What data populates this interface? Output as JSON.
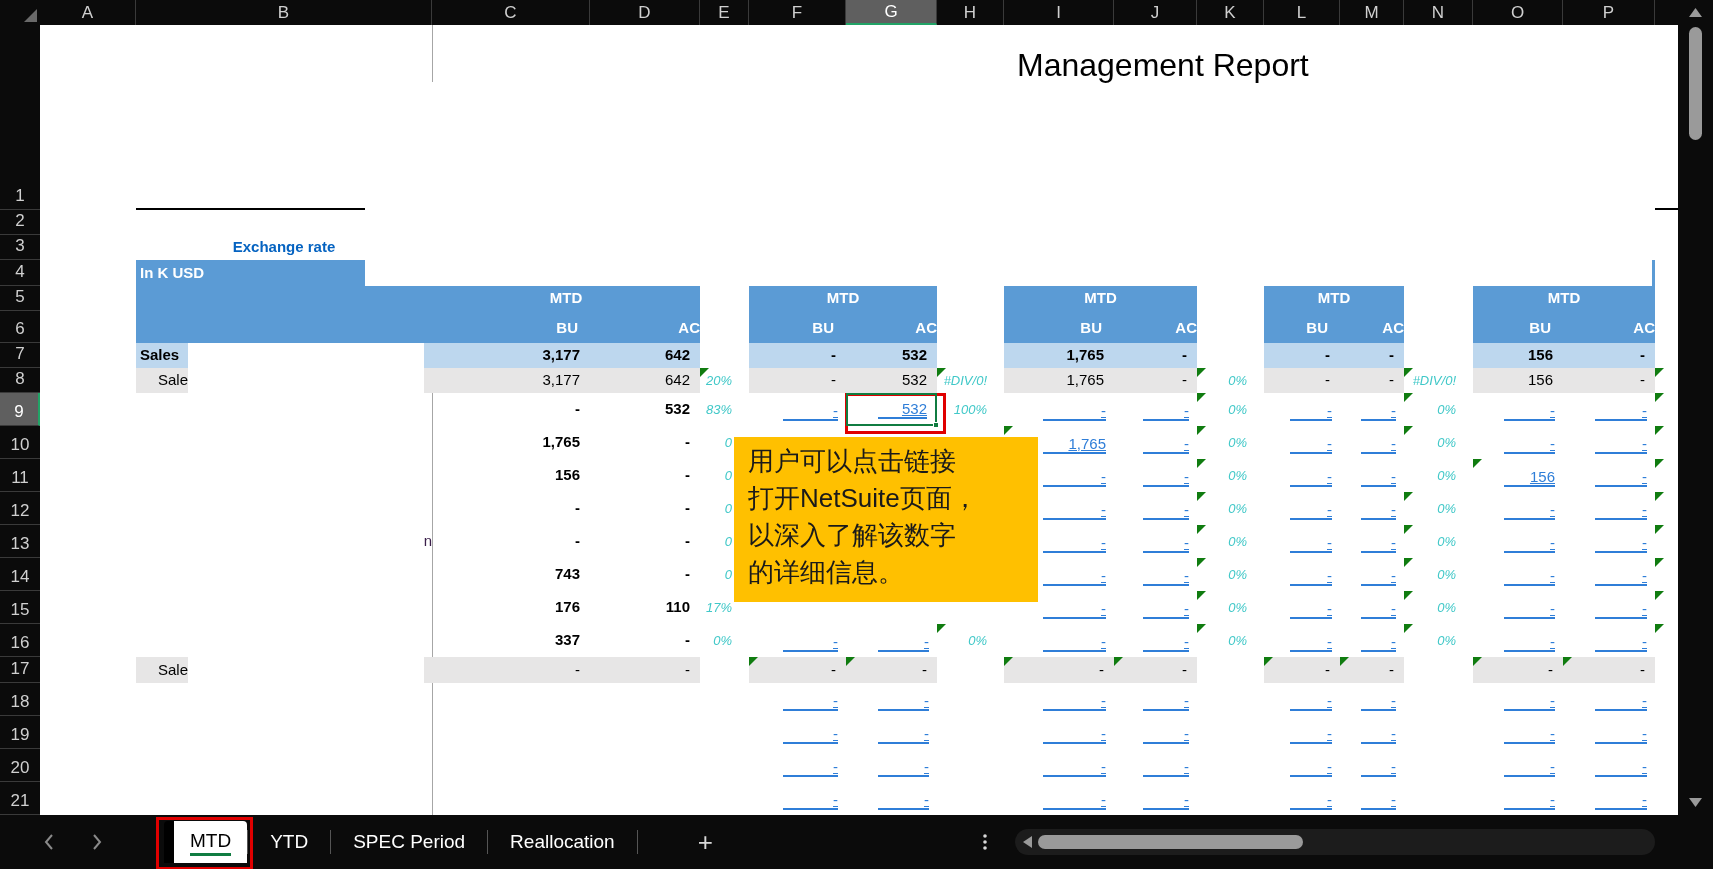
{
  "title": "Management Report",
  "columns": [
    {
      "letter": "A",
      "selected": false,
      "band": false
    },
    {
      "letter": "B",
      "selected": false,
      "band": true
    },
    {
      "letter": "C",
      "selected": false,
      "band": true,
      "group_title": "MTD",
      "subhead": "BU"
    },
    {
      "letter": "D",
      "selected": false,
      "band": true,
      "subhead": "AC"
    },
    {
      "letter": "E",
      "selected": false,
      "band": false
    },
    {
      "letter": "F",
      "selected": false,
      "band": true,
      "group_title": "MTD",
      "subhead": "BU"
    },
    {
      "letter": "G",
      "selected": true,
      "band": true,
      "subhead": "AC"
    },
    {
      "letter": "H",
      "selected": false,
      "band": false
    },
    {
      "letter": "I",
      "selected": false,
      "band": true,
      "group_title": "MTD",
      "subhead": "BU"
    },
    {
      "letter": "J",
      "selected": false,
      "band": true,
      "subhead": "AC"
    },
    {
      "letter": "K",
      "selected": false,
      "band": false
    },
    {
      "letter": "L",
      "selected": false,
      "band": true,
      "group_title": "MTD",
      "subhead": "BU"
    },
    {
      "letter": "M",
      "selected": false,
      "band": true,
      "subhead": "AC"
    },
    {
      "letter": "N",
      "selected": false,
      "band": false
    },
    {
      "letter": "O",
      "selected": false,
      "band": true,
      "group_title": "MTD",
      "subhead": "BU"
    },
    {
      "letter": "P",
      "selected": false,
      "band": true,
      "subhead": "AC"
    }
  ],
  "rows": [
    {
      "number": "1",
      "selected": false,
      "kind": "plain",
      "cells": {}
    },
    {
      "number": "2",
      "selected": false,
      "kind": "plain",
      "cells": {}
    },
    {
      "number": "3",
      "selected": false,
      "kind": "plain",
      "cells": {
        "B": {
          "kind": "note",
          "text": "Exchange rate",
          "flag": false
        }
      }
    },
    {
      "number": "4",
      "selected": false,
      "kind": "plain",
      "cells": {
        "B": {
          "kind": "band_label",
          "text": "In K USD",
          "flag": false
        }
      }
    },
    {
      "number": "5",
      "selected": false,
      "kind": "plain",
      "cells": {}
    },
    {
      "number": "6",
      "selected": false,
      "kind": "plain",
      "cells": {}
    },
    {
      "number": "7",
      "selected": false,
      "kind": "total",
      "cells": {
        "B": {
          "kind": "label",
          "text": "Sales",
          "flag": false
        },
        "C": {
          "kind": "bold",
          "text": "3,177",
          "flag": false
        },
        "D": {
          "kind": "bold",
          "text": "642",
          "flag": false
        },
        "F": {
          "kind": "bold",
          "text": "-",
          "flag": false
        },
        "G": {
          "kind": "bold",
          "text": "532",
          "flag": false
        },
        "I": {
          "kind": "bold",
          "text": "1,765",
          "flag": false
        },
        "J": {
          "kind": "bold",
          "text": "-",
          "flag": false
        },
        "L": {
          "kind": "bold",
          "text": "-",
          "flag": false
        },
        "M": {
          "kind": "bold",
          "text": "-",
          "flag": false
        },
        "O": {
          "kind": "bold",
          "text": "156",
          "flag": false
        },
        "P": {
          "kind": "bold",
          "text": "-",
          "flag": false
        }
      }
    },
    {
      "number": "8",
      "selected": false,
      "kind": "subtotal",
      "cells": {
        "B": {
          "kind": "sublabel",
          "text": "Sale",
          "flag": false
        },
        "C": {
          "kind": "value",
          "text": "3,177",
          "flag": false
        },
        "D": {
          "kind": "value",
          "text": "642",
          "flag": false
        },
        "E": {
          "kind": "pct",
          "text": "20%",
          "flag": true
        },
        "F": {
          "kind": "value",
          "text": "-",
          "flag": false
        },
        "G": {
          "kind": "value",
          "text": "532",
          "flag": false
        },
        "H": {
          "kind": "pct",
          "text": "#DIV/0!",
          "flag": true
        },
        "I": {
          "kind": "value",
          "text": "1,765",
          "flag": false
        },
        "J": {
          "kind": "value",
          "text": "-",
          "flag": false
        },
        "K": {
          "kind": "pct",
          "text": "0%",
          "flag": true
        },
        "L": {
          "kind": "value",
          "text": "-",
          "flag": false
        },
        "M": {
          "kind": "value",
          "text": "-",
          "flag": false
        },
        "N": {
          "kind": "pct",
          "text": "#DIV/0!",
          "flag": true
        },
        "O": {
          "kind": "value",
          "text": "156",
          "flag": false
        },
        "P": {
          "kind": "value",
          "text": "-",
          "flag": false
        },
        "Q": {
          "flag": true
        }
      }
    },
    {
      "number": "9",
      "selected": true,
      "kind": "plain",
      "cells": {
        "C": {
          "kind": "bold",
          "text": "-",
          "flag": false
        },
        "D": {
          "kind": "bold",
          "text": "532",
          "flag": false
        },
        "E": {
          "kind": "pct",
          "text": "83%",
          "flag": false
        },
        "F": {
          "kind": "link",
          "text": "-",
          "flag": false
        },
        "G": {
          "kind": "link",
          "text": "532",
          "flag": false
        },
        "H": {
          "kind": "pct",
          "text": "100%",
          "flag": false
        },
        "I": {
          "kind": "link",
          "text": "-",
          "flag": false
        },
        "J": {
          "kind": "link",
          "text": "-",
          "flag": false
        },
        "K": {
          "kind": "pct",
          "text": "0%",
          "flag": true
        },
        "L": {
          "kind": "link",
          "text": "-",
          "flag": false
        },
        "M": {
          "kind": "link",
          "text": "-",
          "flag": false
        },
        "N": {
          "kind": "pct",
          "text": "0%",
          "flag": true
        },
        "O": {
          "kind": "link",
          "text": "-",
          "flag": false
        },
        "P": {
          "kind": "link",
          "text": "-",
          "flag": false
        },
        "Q": {
          "flag": true
        }
      }
    },
    {
      "number": "10",
      "selected": false,
      "kind": "plain",
      "cells": {
        "C": {
          "kind": "bold",
          "text": "1,765",
          "flag": false
        },
        "D": {
          "kind": "bold",
          "text": "-",
          "flag": false
        },
        "E": {
          "kind": "pct",
          "text": "0",
          "flag": false
        },
        "I": {
          "kind": "link",
          "text": "1,765",
          "flag": true
        },
        "J": {
          "kind": "link",
          "text": "-",
          "flag": false
        },
        "K": {
          "kind": "pct",
          "text": "0%",
          "flag": true
        },
        "L": {
          "kind": "link",
          "text": "-",
          "flag": false
        },
        "M": {
          "kind": "link",
          "text": "-",
          "flag": false
        },
        "N": {
          "kind": "pct",
          "text": "0%",
          "flag": true
        },
        "O": {
          "kind": "link",
          "text": "-",
          "flag": false
        },
        "P": {
          "kind": "link",
          "text": "-",
          "flag": false
        },
        "Q": {
          "flag": true
        }
      }
    },
    {
      "number": "11",
      "selected": false,
      "kind": "plain",
      "cells": {
        "C": {
          "kind": "bold",
          "text": "156",
          "flag": false
        },
        "D": {
          "kind": "bold",
          "text": "-",
          "flag": false
        },
        "E": {
          "kind": "pct",
          "text": "0",
          "flag": false
        },
        "I": {
          "kind": "link",
          "text": "-",
          "flag": false
        },
        "J": {
          "kind": "link",
          "text": "-",
          "flag": false
        },
        "K": {
          "kind": "pct",
          "text": "0%",
          "flag": true
        },
        "L": {
          "kind": "link",
          "text": "-",
          "flag": false
        },
        "M": {
          "kind": "link",
          "text": "-",
          "flag": false
        },
        "N": {
          "kind": "pct",
          "text": "0%",
          "flag": false
        },
        "O": {
          "kind": "link",
          "text": "156",
          "flag": true
        },
        "P": {
          "kind": "link",
          "text": "-",
          "flag": false
        },
        "Q": {
          "flag": true
        }
      }
    },
    {
      "number": "12",
      "selected": false,
      "kind": "plain",
      "cells": {
        "C": {
          "kind": "bold",
          "text": "-",
          "flag": false
        },
        "D": {
          "kind": "bold",
          "text": "-",
          "flag": false
        },
        "E": {
          "kind": "pct",
          "text": "0",
          "flag": false
        },
        "I": {
          "kind": "link",
          "text": "-",
          "flag": false
        },
        "J": {
          "kind": "link",
          "text": "-",
          "flag": false
        },
        "K": {
          "kind": "pct",
          "text": "0%",
          "flag": true
        },
        "L": {
          "kind": "link",
          "text": "-",
          "flag": false
        },
        "M": {
          "kind": "link",
          "text": "-",
          "flag": false
        },
        "N": {
          "kind": "pct",
          "text": "0%",
          "flag": true
        },
        "O": {
          "kind": "link",
          "text": "-",
          "flag": false
        },
        "P": {
          "kind": "link",
          "text": "-",
          "flag": false
        },
        "Q": {
          "flag": true
        }
      }
    },
    {
      "number": "13",
      "selected": false,
      "kind": "plain",
      "cells": {
        "B": {
          "kind": "fragment",
          "text": "n",
          "flag": false
        },
        "C": {
          "kind": "bold",
          "text": "-",
          "flag": false
        },
        "D": {
          "kind": "bold",
          "text": "-",
          "flag": false
        },
        "E": {
          "kind": "pct",
          "text": "0",
          "flag": false
        },
        "I": {
          "kind": "link",
          "text": "-",
          "flag": false
        },
        "J": {
          "kind": "link",
          "text": "-",
          "flag": false
        },
        "K": {
          "kind": "pct",
          "text": "0%",
          "flag": true
        },
        "L": {
          "kind": "link",
          "text": "-",
          "flag": false
        },
        "M": {
          "kind": "link",
          "text": "-",
          "flag": false
        },
        "N": {
          "kind": "pct",
          "text": "0%",
          "flag": true
        },
        "O": {
          "kind": "link",
          "text": "-",
          "flag": false
        },
        "P": {
          "kind": "link",
          "text": "-",
          "flag": false
        },
        "Q": {
          "flag": true
        }
      }
    },
    {
      "number": "14",
      "selected": false,
      "kind": "plain",
      "cells": {
        "C": {
          "kind": "bold",
          "text": "743",
          "flag": false
        },
        "D": {
          "kind": "bold",
          "text": "-",
          "flag": false
        },
        "E": {
          "kind": "pct",
          "text": "0",
          "flag": false
        },
        "I": {
          "kind": "link",
          "text": "-",
          "flag": false
        },
        "J": {
          "kind": "link",
          "text": "-",
          "flag": false
        },
        "K": {
          "kind": "pct",
          "text": "0%",
          "flag": true
        },
        "L": {
          "kind": "link",
          "text": "-",
          "flag": false
        },
        "M": {
          "kind": "link",
          "text": "-",
          "flag": false
        },
        "N": {
          "kind": "pct",
          "text": "0%",
          "flag": true
        },
        "O": {
          "kind": "link",
          "text": "-",
          "flag": false
        },
        "P": {
          "kind": "link",
          "text": "-",
          "flag": false
        },
        "Q": {
          "flag": true
        }
      }
    },
    {
      "number": "15",
      "selected": false,
      "kind": "plain",
      "cells": {
        "C": {
          "kind": "bold",
          "text": "176",
          "flag": false
        },
        "D": {
          "kind": "bold",
          "text": "110",
          "flag": false
        },
        "E": {
          "kind": "pct",
          "text": "17%",
          "flag": false
        },
        "I": {
          "kind": "link",
          "text": "-",
          "flag": false
        },
        "J": {
          "kind": "link",
          "text": "-",
          "flag": false
        },
        "K": {
          "kind": "pct",
          "text": "0%",
          "flag": true
        },
        "L": {
          "kind": "link",
          "text": "-",
          "flag": false
        },
        "M": {
          "kind": "link",
          "text": "-",
          "flag": false
        },
        "N": {
          "kind": "pct",
          "text": "0%",
          "flag": true
        },
        "O": {
          "kind": "link",
          "text": "-",
          "flag": false
        },
        "P": {
          "kind": "link",
          "text": "-",
          "flag": false
        },
        "Q": {
          "flag": true
        }
      }
    },
    {
      "number": "16",
      "selected": false,
      "kind": "plain",
      "cells": {
        "C": {
          "kind": "bold",
          "text": "337",
          "flag": false
        },
        "D": {
          "kind": "bold",
          "text": "-",
          "flag": false
        },
        "E": {
          "kind": "pct",
          "text": "0%",
          "flag": false
        },
        "F": {
          "kind": "link",
          "text": "-",
          "flag": false
        },
        "G": {
          "kind": "link",
          "text": "-",
          "flag": false
        },
        "H": {
          "kind": "pct",
          "text": "0%",
          "flag": true
        },
        "I": {
          "kind": "link",
          "text": "-",
          "flag": false
        },
        "J": {
          "kind": "link",
          "text": "-",
          "flag": false
        },
        "K": {
          "kind": "pct",
          "text": "0%",
          "flag": true
        },
        "L": {
          "kind": "link",
          "text": "-",
          "flag": false
        },
        "M": {
          "kind": "link",
          "text": "-",
          "flag": false
        },
        "N": {
          "kind": "pct",
          "text": "0%",
          "flag": true
        },
        "O": {
          "kind": "link",
          "text": "-",
          "flag": false
        },
        "P": {
          "kind": "link",
          "text": "-",
          "flag": false
        },
        "Q": {
          "flag": true
        }
      }
    },
    {
      "number": "17",
      "selected": false,
      "kind": "subtotal",
      "cells": {
        "B": {
          "kind": "sublabel",
          "text": "Sale",
          "flag": false
        },
        "C": {
          "kind": "value",
          "text": "-",
          "flag": false
        },
        "D": {
          "kind": "value",
          "text": "-",
          "flag": false
        },
        "F": {
          "kind": "value",
          "text": "-",
          "flag": true
        },
        "G": {
          "kind": "value",
          "text": "-",
          "flag": true
        },
        "I": {
          "kind": "value",
          "text": "-",
          "flag": true
        },
        "J": {
          "kind": "value",
          "text": "-",
          "flag": true
        },
        "L": {
          "kind": "value",
          "text": "-",
          "flag": true
        },
        "M": {
          "kind": "value",
          "text": "-",
          "flag": true
        },
        "O": {
          "kind": "value",
          "text": "-",
          "flag": true
        },
        "P": {
          "kind": "value",
          "text": "-",
          "flag": true
        }
      }
    },
    {
      "number": "18",
      "selected": false,
      "kind": "plain",
      "cells": {
        "F": {
          "kind": "link",
          "text": "-",
          "flag": false
        },
        "G": {
          "kind": "link",
          "text": "-",
          "flag": false
        },
        "I": {
          "kind": "link",
          "text": "-",
          "flag": false
        },
        "J": {
          "kind": "link",
          "text": "-",
          "flag": false
        },
        "L": {
          "kind": "link",
          "text": "-",
          "flag": false
        },
        "M": {
          "kind": "link",
          "text": "-",
          "flag": false
        },
        "O": {
          "kind": "link",
          "text": "-",
          "flag": false
        },
        "P": {
          "kind": "link",
          "text": "-",
          "flag": false
        }
      }
    },
    {
      "number": "19",
      "selected": false,
      "kind": "plain",
      "cells": {
        "F": {
          "kind": "link",
          "text": "-",
          "flag": false
        },
        "G": {
          "kind": "link",
          "text": "-",
          "flag": false
        },
        "I": {
          "kind": "link",
          "text": "-",
          "flag": false
        },
        "J": {
          "kind": "link",
          "text": "-",
          "flag": false
        },
        "L": {
          "kind": "link",
          "text": "-",
          "flag": false
        },
        "M": {
          "kind": "link",
          "text": "-",
          "flag": false
        },
        "O": {
          "kind": "link",
          "text": "-",
          "flag": false
        },
        "P": {
          "kind": "link",
          "text": "-",
          "flag": false
        }
      }
    },
    {
      "number": "20",
      "selected": false,
      "kind": "plain",
      "cells": {
        "F": {
          "kind": "link",
          "text": "-",
          "flag": false
        },
        "G": {
          "kind": "link",
          "text": "-",
          "flag": false
        },
        "I": {
          "kind": "link",
          "text": "-",
          "flag": false
        },
        "J": {
          "kind": "link",
          "text": "-",
          "flag": false
        },
        "L": {
          "kind": "link",
          "text": "-",
          "flag": false
        },
        "M": {
          "kind": "link",
          "text": "-",
          "flag": false
        },
        "O": {
          "kind": "link",
          "text": "-",
          "flag": false
        },
        "P": {
          "kind": "link",
          "text": "-",
          "flag": false
        }
      }
    },
    {
      "number": "21",
      "selected": false,
      "kind": "plain",
      "cells": {
        "F": {
          "kind": "link",
          "text": "-",
          "flag": false
        },
        "G": {
          "kind": "link",
          "text": "-",
          "flag": false
        },
        "I": {
          "kind": "link",
          "text": "-",
          "flag": false
        },
        "J": {
          "kind": "link",
          "text": "-",
          "flag": false
        },
        "L": {
          "kind": "link",
          "text": "-",
          "flag": false
        },
        "M": {
          "kind": "link",
          "text": "-",
          "flag": false
        },
        "O": {
          "kind": "link",
          "text": "-",
          "flag": false
        },
        "P": {
          "kind": "link",
          "text": "-",
          "flag": false
        }
      }
    }
  ],
  "callout": {
    "lines": [
      "用户可以点击链接",
      "打开NetSuite页面，",
      "以深入了解该数字",
      "的详细信息。"
    ]
  },
  "sheet_tabs": [
    {
      "label": "MTD",
      "selected": true
    },
    {
      "label": "YTD",
      "selected": false
    },
    {
      "label": "SPEC Period",
      "selected": false
    },
    {
      "label": "Reallocation",
      "selected": false
    }
  ],
  "new_sheet_button": "+"
}
